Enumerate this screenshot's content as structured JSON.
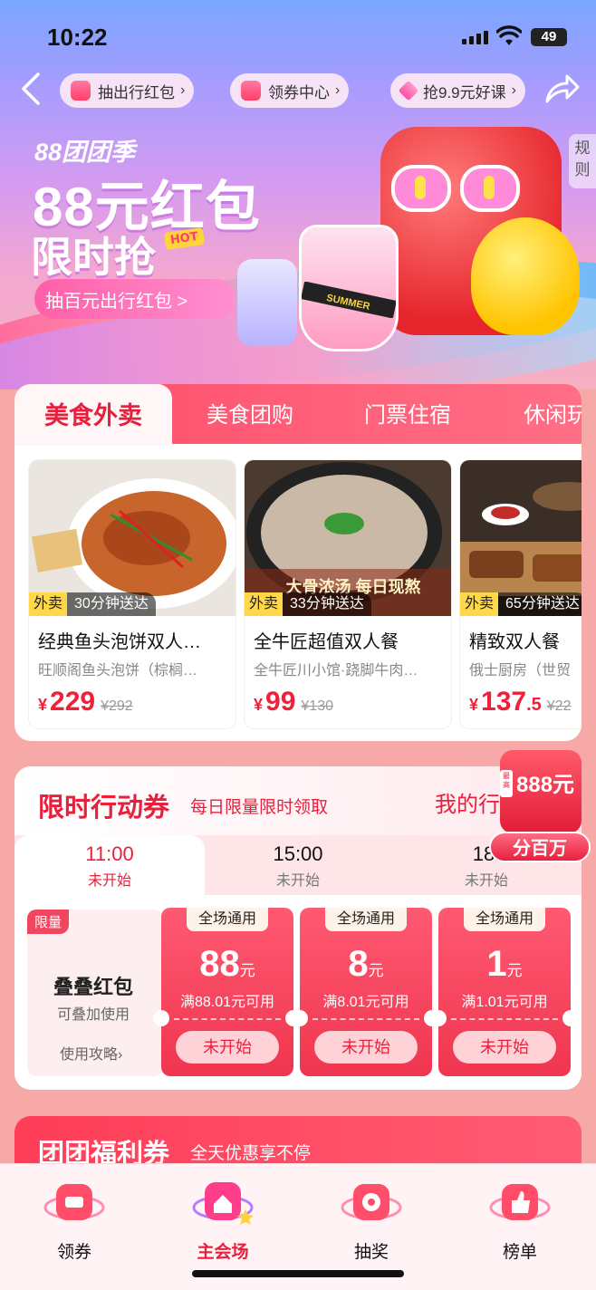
{
  "status": {
    "time": "10:22",
    "battery": "49"
  },
  "header": {
    "chips": [
      {
        "label": "抽出行红包"
      },
      {
        "label": "领券中心"
      },
      {
        "label": "抢9.9元好课"
      }
    ]
  },
  "hero": {
    "season": "88团团季",
    "title": "88元红包",
    "subtitle": "限时抢",
    "hot_badge": "HOT",
    "cta": "抽百元出行红包 >",
    "rules": "规则",
    "cup_text": "SUMMER"
  },
  "food": {
    "tabs": [
      {
        "label": "美食外卖"
      },
      {
        "label": "美食团购"
      },
      {
        "label": "门票住宿"
      },
      {
        "label": "休闲玩"
      }
    ],
    "items": [
      {
        "tag": "外卖",
        "delivery": "30分钟送达",
        "name": "经典鱼头泡饼双人…",
        "shop": "旺顺阁鱼头泡饼（棕榈…",
        "currency": "¥",
        "price": "229",
        "price_dec": "",
        "old_price": "¥292"
      },
      {
        "tag": "外卖",
        "delivery": "33分钟送达",
        "name": "全牛匠超值双人餐",
        "shop": "全牛匠川小馆·跷脚牛肉…",
        "currency": "¥",
        "price": "99",
        "price_dec": "",
        "old_price": "¥130"
      },
      {
        "tag": "外卖",
        "delivery": "65分钟送达",
        "name": "精致双人餐",
        "shop": "俄士厨房（世贸",
        "currency": "¥",
        "price": "137",
        "price_dec": ".5",
        "old_price": "¥22"
      }
    ],
    "photo2_overlay": "大骨浓汤 每日现熬"
  },
  "coupons": {
    "title": "限时行动券",
    "subtitle": "每日限量限时领取",
    "my_link": "我的行",
    "slots": [
      {
        "time": "11:00",
        "status": "未开始"
      },
      {
        "time": "15:00",
        "status": "未开始"
      },
      {
        "time": "18:",
        "status": "未开始"
      }
    ],
    "stack": {
      "limit": "限量",
      "name": "叠叠红包",
      "desc": "可叠加使用",
      "guide": "使用攻略›"
    },
    "tickets": [
      {
        "badge": "全场通用",
        "amount": "88",
        "unit": "元",
        "condition": "满88.01元可用",
        "button": "未开始"
      },
      {
        "badge": "全场通用",
        "amount": "8",
        "unit": "元",
        "condition": "满8.01元可用",
        "button": "未开始"
      },
      {
        "badge": "全场通用",
        "amount": "1",
        "unit": "元",
        "condition": "满1.01元可用",
        "button": "未开始"
      }
    ]
  },
  "floating": {
    "max": "最高",
    "amount": "888元",
    "button": "分百万"
  },
  "welfare": {
    "title": "团团福利券",
    "subtitle": "全天优惠享不停"
  },
  "tabbar": {
    "items": [
      {
        "label": "领券"
      },
      {
        "label": "主会场"
      },
      {
        "label": "抽奖"
      },
      {
        "label": "榜单"
      }
    ]
  },
  "colors": {
    "accent": "#e8203c",
    "brand_pink": "#ff4d6a",
    "page_bg": "#f7a9a7"
  }
}
